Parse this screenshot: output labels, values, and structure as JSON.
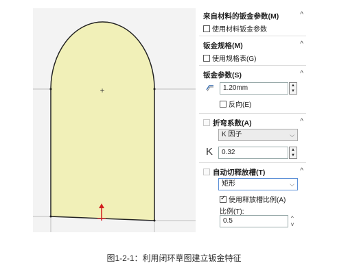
{
  "viewport": {
    "shape_fill": "#f1f0b8",
    "shape_stroke": "#222222",
    "background": "#f3f3f3"
  },
  "panel": {
    "material_params": {
      "title": "来自材料的钣金参数(M)",
      "checkbox_label": "使用材料钣金参数",
      "checked": false
    },
    "gauge": {
      "title": "钣金规格(M)",
      "checkbox_label": "使用规格表(G)",
      "checked": false
    },
    "sheet_params": {
      "title": "钣金参数(S)",
      "thickness_value": "1.20mm",
      "reverse_label": "反向(E)",
      "reverse_checked": false
    },
    "bend_allowance": {
      "title": "折弯系数(A)",
      "type_value": "K 因子",
      "k_symbol": "K",
      "k_value": "0.32"
    },
    "auto_relief": {
      "title": "自动切释放槽(T)",
      "type_value": "矩形",
      "ratio_checkbox_label": "使用释放槽比例(A)",
      "ratio_checked": true,
      "ratio_label": "比例(T):",
      "ratio_value": "0.5"
    }
  },
  "caption": "图1-2-1：利用闭环草图建立钣金特征"
}
